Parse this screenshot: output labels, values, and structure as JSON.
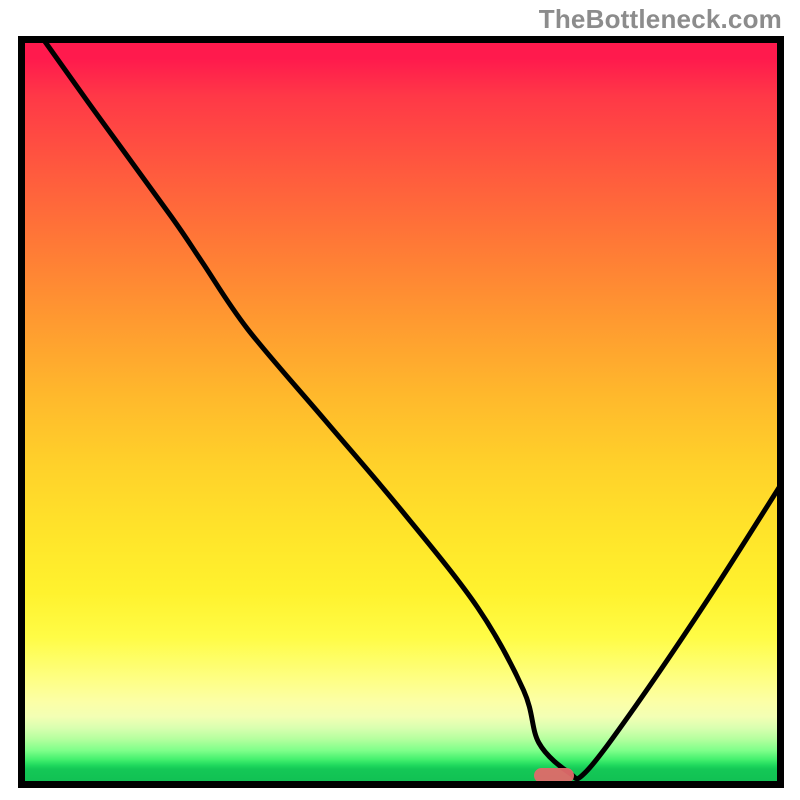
{
  "watermark": "TheBottleneck.com",
  "chart_data": {
    "type": "line",
    "title": "",
    "xlabel": "",
    "ylabel": "",
    "xlim": [
      0,
      100
    ],
    "ylim": [
      0,
      100
    ],
    "grid": false,
    "legend": false,
    "description": "Bottleneck curve over red-to-green vertical gradient. Curve falls steeply from upper-left, reaches a valley near x≈70 at y≈2, then rises toward the right edge. A small pink rounded marker sits at the valley bottom.",
    "series": [
      {
        "name": "bottleneck-curve",
        "x": [
          3,
          10,
          20,
          24,
          30,
          40,
          50,
          60,
          66,
          68,
          72,
          74,
          80,
          90,
          100
        ],
        "y": [
          100,
          90,
          76,
          70,
          61,
          49,
          37,
          24,
          13,
          6,
          2,
          2,
          10,
          25,
          41
        ]
      }
    ],
    "marker": {
      "x": 70,
      "y": 1.7,
      "color": "#e06a6a"
    },
    "gradient_stops": [
      {
        "pos": 0,
        "color": "#ff1a4d",
        "meaning": "worst"
      },
      {
        "pos": 0.5,
        "color": "#ffb92c"
      },
      {
        "pos": 0.75,
        "color": "#fff22e"
      },
      {
        "pos": 0.9,
        "color": "#feff7e"
      },
      {
        "pos": 0.97,
        "color": "#1fd85d"
      },
      {
        "pos": 1.0,
        "color": "#0fbd52",
        "meaning": "best"
      }
    ]
  }
}
